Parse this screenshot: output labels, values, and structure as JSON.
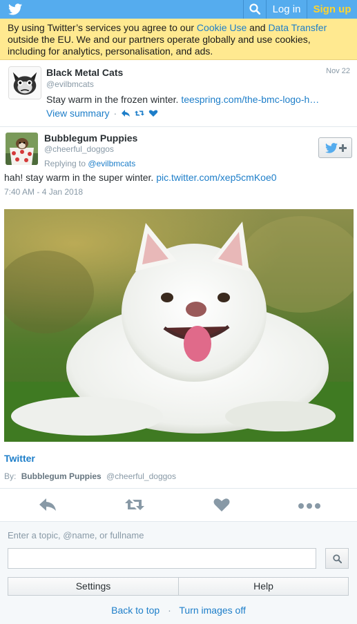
{
  "colors": {
    "brand": "#55acee",
    "link": "#1d7ec9",
    "signup": "#ffd42d",
    "cookie_bg": "#ffe990",
    "muted": "#8899a6"
  },
  "topbar": {
    "logo_icon": "twitter-bird-icon",
    "search_icon": "search-icon",
    "login_label": "Log in",
    "signup_label": "Sign up"
  },
  "cookie_banner": {
    "text_1": "By using Twitter’s services you agree to our ",
    "link_cookie": "Cookie Use",
    "text_2": " and ",
    "link_transfer": "Data Transfer",
    "text_3": " outside the EU. We and our partners operate globally and use cookies, including for analytics, personalisation, and ads."
  },
  "parent_tweet": {
    "name": "Black Metal Cats",
    "handle": "@evilbmcats",
    "date": "Nov 22",
    "text": "Stay warm in the frozen winter. ",
    "link": "teespring.com/the-bmc-logo-h…",
    "view_summary": "View summary",
    "separator": "·"
  },
  "main_tweet": {
    "name": "Bubblegum Puppies",
    "handle": "@cheerful_doggos",
    "reply_prefix": "Replying to ",
    "reply_to": "@evilbmcats",
    "text": "hah! stay warm in the super winter. ",
    "link": "pic.twitter.com/xep5cmKoe0",
    "timestamp": "7:40 AM - 4 Jan 2018"
  },
  "card": {
    "title": "Twitter",
    "by_label": "By:",
    "by_name": "Bubblegum Puppies",
    "by_handle": "@cheerful_doggos"
  },
  "actions": {
    "reply_icon": "reply-icon",
    "retweet_icon": "retweet-icon",
    "like_icon": "heart-icon",
    "more_icon": "more-icon"
  },
  "footer": {
    "search_placeholder_label": "Enter a topic, @name, or fullname",
    "search_value": "",
    "settings_label": "Settings",
    "help_label": "Help",
    "back_to_top": "Back to top",
    "separator": "·",
    "turn_images_off": "Turn images off"
  }
}
